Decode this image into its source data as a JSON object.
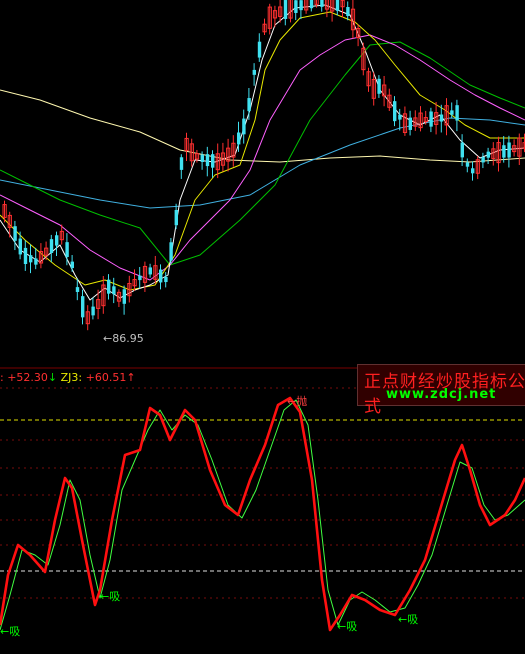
{
  "price_panel": {
    "low_marker": "←86.95"
  },
  "indicator": {
    "zj2_value": ": +52.30",
    "zj2_arrow": "↓",
    "zj3_name": "ZJ3:",
    "zj3_value": "+60.51",
    "zj3_arrow": "↑",
    "signals": {
      "sell": "抛",
      "buy": "吸"
    }
  },
  "brand": {
    "title": "正点财经炒股指标公式",
    "url": "www.zdcj.net"
  },
  "colors": {
    "background": "#000000",
    "up_candle": "#ff3030",
    "down_candle": "#40e0f0",
    "ma5": "#ffffff",
    "ma10": "#e8e800",
    "ma20": "#ff60ff",
    "ma30": "#00c000",
    "ma60": "#40b0e0",
    "ma120": "#fff8b0",
    "zj_fast": "#ff1010",
    "zj_slow": "#40ff40",
    "ref_line": "#e0e000",
    "grid": "#a01010"
  }
}
